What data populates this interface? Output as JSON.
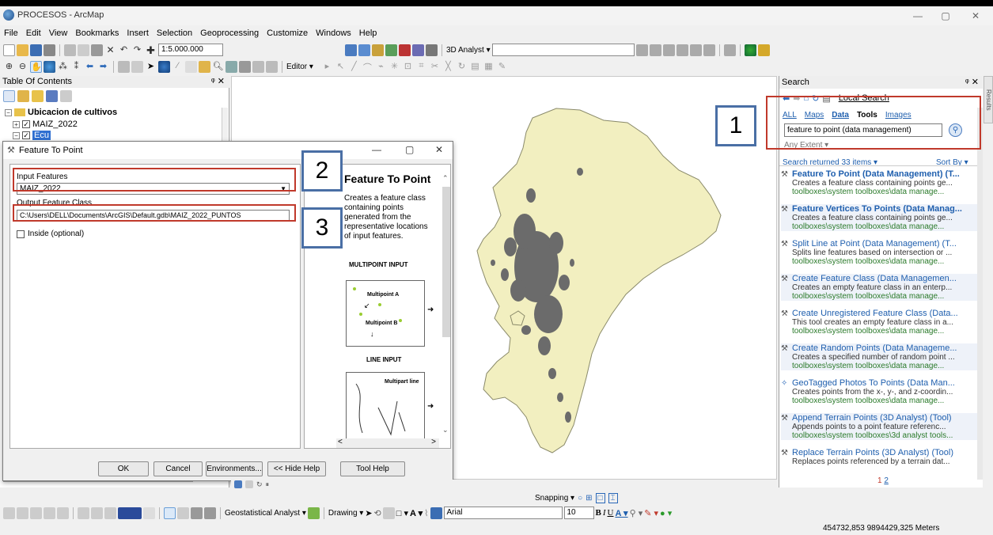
{
  "window": {
    "title": "PROCESOS - ArcMap",
    "controls": [
      "—",
      "▢",
      "✕"
    ]
  },
  "menu": [
    "File",
    "Edit",
    "View",
    "Bookmarks",
    "Insert",
    "Selection",
    "Geoprocessing",
    "Customize",
    "Windows",
    "Help"
  ],
  "toolbar": {
    "scale": "1:5.000.000",
    "analyst_3d": "3D Analyst ▾",
    "editor": "Editor ▾"
  },
  "toc": {
    "title": "Table Of Contents",
    "pin": "ᵠ ✕",
    "group": "Ubicacion de cultivos",
    "layer1": "MAIZ_2022",
    "layer2": "Ecu"
  },
  "dialog": {
    "title": "Feature To Point",
    "input_label": "Input Features",
    "input_value": "MAIZ_2022",
    "output_label": "Output Feature Class",
    "output_value": "C:\\Users\\DELL\\Documents\\ArcGIS\\Default.gdb\\MAIZ_2022_PUNTOS",
    "inside_label": "Inside (optional)",
    "buttons": {
      "ok": "OK",
      "cancel": "Cancel",
      "environments": "Environments...",
      "hide_help": "<< Hide Help",
      "tool_help": "Tool Help"
    },
    "help": {
      "title": "Feature To Point",
      "body": "Creates a feature class containing points generated from the representative locations of input features.",
      "body_lines": [
        "Creates a feature class",
        "containing points",
        "generated from the",
        "representative locations",
        "of input features."
      ],
      "multipoint_heading": "MULTIPOINT INPUT",
      "multipoint_a": "Multipoint A",
      "multipoint_b": "Multipoint B",
      "line_heading": "LINE INPUT",
      "multipart_line": "Multipart line"
    }
  },
  "search": {
    "title": "Search",
    "location": "Local Search",
    "tabs": [
      "ALL",
      "Maps",
      "Data",
      "Tools",
      "Images"
    ],
    "query": "feature to point (data management)",
    "extent": "Any Extent ▾",
    "returned": "Search returned 33 items ▾",
    "sort": "Sort By ▾",
    "side_tab": "Results",
    "results": [
      {
        "title": "Feature To Point (Data Management) (T...",
        "desc": "Creates a feature class containing points ge...",
        "path": "toolboxes\\system toolboxes\\data manage..."
      },
      {
        "title": "Feature Vertices To Points (Data Manag...",
        "desc": "Creates a feature class containing points ge...",
        "path": "toolboxes\\system toolboxes\\data manage..."
      },
      {
        "title": "Split Line at Point (Data Management) (T...",
        "desc": "Splits line features based on intersection or ...",
        "path": "toolboxes\\system toolboxes\\data manage..."
      },
      {
        "title": "Create Feature Class (Data Managemen...",
        "desc": "Creates an empty feature class in an enterp...",
        "path": "toolboxes\\system toolboxes\\data manage..."
      },
      {
        "title": "Create Unregistered Feature Class (Data...",
        "desc": "This tool creates an empty feature class in a...",
        "path": "toolboxes\\system toolboxes\\data manage..."
      },
      {
        "title": "Create Random Points (Data Manageme...",
        "desc": "Creates a specified number of random point ...",
        "path": "toolboxes\\system toolboxes\\data manage..."
      },
      {
        "title": "GeoTagged Photos To Points (Data Man...",
        "desc": "Creates points from the x-, y-, and z-coordin...",
        "path": "toolboxes\\system toolboxes\\data manage..."
      },
      {
        "title": "Append Terrain Points (3D Analyst) (Tool)",
        "desc": "Appends points to a point feature referenc...",
        "path": "toolboxes\\system toolboxes\\3d analyst tools..."
      },
      {
        "title": "Replace Terrain Points (3D Analyst) (Tool)",
        "desc": "Replaces points referenced by a terrain dat...",
        "path": ""
      }
    ],
    "pages": {
      "current": "1",
      "next": "2"
    }
  },
  "callouts": {
    "one": "1",
    "two": "2",
    "three": "3"
  },
  "bottom": {
    "snapping": "Snapping ▾",
    "geostatistical": "Geostatistical Analyst ▾",
    "drawing": "Drawing ▾",
    "font": "Arial",
    "font_size": "10",
    "bold": "B",
    "italic": "I",
    "underline": "U",
    "coords": "454732,853  9894429,325 Meters"
  }
}
